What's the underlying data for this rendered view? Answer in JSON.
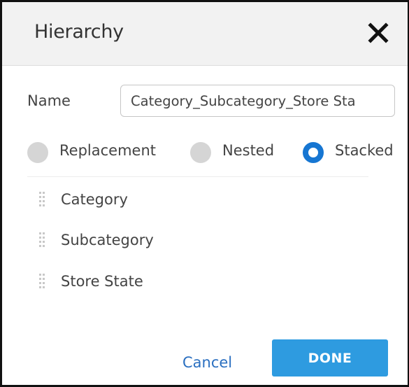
{
  "dialog": {
    "title": "Hierarchy",
    "close_icon": "close-icon"
  },
  "form": {
    "name_label": "Name",
    "name_value": "Category_Subcategory_Store Sta"
  },
  "mode": {
    "selected": "Stacked",
    "options": [
      {
        "label": "Replacement",
        "selected": false
      },
      {
        "label": "Nested",
        "selected": false
      },
      {
        "label": "Stacked",
        "selected": true
      }
    ]
  },
  "levels": [
    {
      "label": "Category",
      "icon": "drag-handle-icon"
    },
    {
      "label": "Subcategory",
      "icon": "drag-handle-icon"
    },
    {
      "label": "Store State",
      "icon": "drag-handle-icon"
    }
  ],
  "footer": {
    "cancel_label": "Cancel",
    "done_label": "DONE"
  },
  "colors": {
    "accent": "#1676d2",
    "done_button": "#2e9be0",
    "link": "#2a6fc0",
    "header_bg": "#f2f2f2",
    "radio_unselected": "#d5d5d5"
  }
}
